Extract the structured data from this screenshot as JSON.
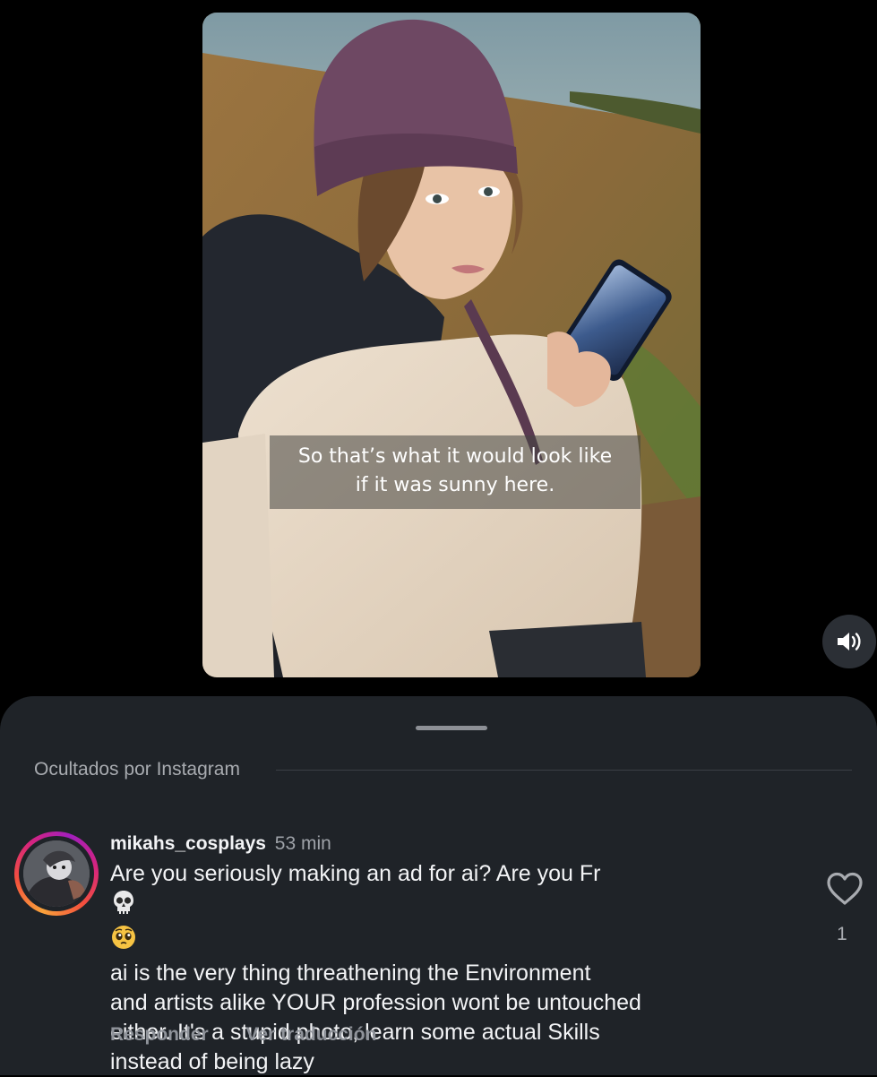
{
  "video": {
    "caption_line1": "So that’s what it would look like",
    "caption_line2": "if it was sunny here.",
    "sound_icon": "speaker-sound-icon"
  },
  "comments_sheet": {
    "hidden_label": "Ocultados por Instagram",
    "comment": {
      "username": "mikahs_cosplays",
      "time": "53 min",
      "lines": [
        "Are you seriously making an ad for ai? Are you Fr",
        "ai is the very thing threathening the Environment",
        "and artists alike YOUR profession wont be untouched",
        "either. It's a stupid photo, learn some actual Skills",
        "instead of being lazy"
      ],
      "emojis": [
        "skull-emoji",
        "pleading-face-emoji"
      ],
      "reply_label": "Responder",
      "translate_label": "Ver traducción",
      "like_count": "1"
    }
  },
  "colors": {
    "background": "#000000",
    "sheet": "#1f2328",
    "text_primary": "#f2f3f5",
    "text_muted": "#9ea2a8"
  }
}
